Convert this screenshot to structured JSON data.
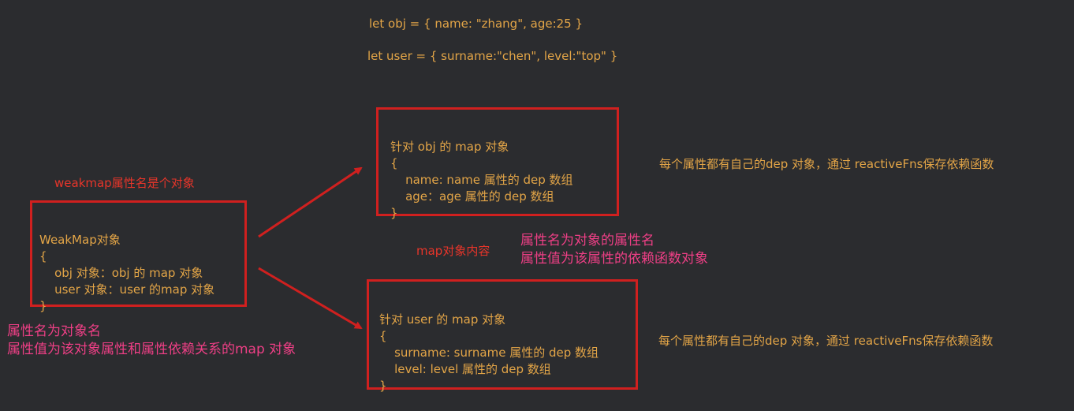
{
  "code": {
    "obj_line": "let obj = { name: \"zhang\", age:25 }",
    "user_line": "let user = { surname:\"chen\", level:\"top\" }"
  },
  "weakmap_box": {
    "title": "WeakMap对象",
    "open_brace": "{",
    "line1": "    obj 对象：obj 的 map 对象",
    "line2": "    user 对象：user 的map 对象",
    "close_brace": "}"
  },
  "obj_box": {
    "title": "针对 obj 的 map 对象",
    "open_brace": "{",
    "line1": "    name: name 属性的 dep 数组",
    "line2": "    age：age 属性的 dep 数组",
    "close_brace": "}"
  },
  "user_box": {
    "title": "针对 user 的 map 对象",
    "open_brace": "{",
    "line1": "    surname: surname 属性的 dep 数组",
    "line2": "    level: level 属性的 dep 数组",
    "close_brace": "}"
  },
  "notes": {
    "weakmap_key": "weakmap属性名是个对象",
    "weakmap_desc_1": "属性名为对象名",
    "weakmap_desc_2": "属性值为该对象属性和属性依赖关系的map 对象",
    "map_content": "map对象内容",
    "map_desc_1": "属性名为对象的属性名",
    "map_desc_2": "属性值为该属性的依赖函数对象",
    "obj_dep_note": "每个属性都有自己的dep 对象，通过 reactiveFns保存依赖函数",
    "user_dep_note": "每个属性都有自己的dep 对象，通过 reactiveFns保存依赖函数"
  },
  "colors": {
    "background": "#2b2c2f",
    "box_border": "#d0201f",
    "code_text": "#e3a547",
    "red_note": "#e8352a",
    "pink_note": "#ef3f86"
  }
}
